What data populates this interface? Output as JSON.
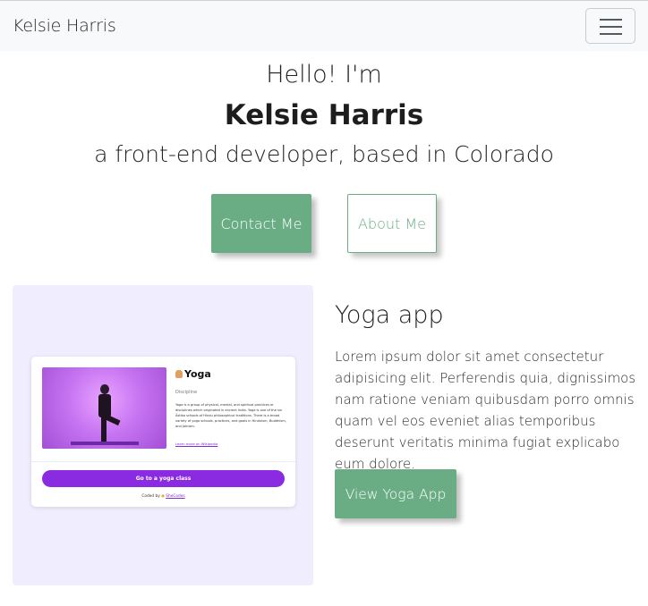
{
  "navbar": {
    "brand": "Kelsie Harris",
    "toggler_icon": "hamburger-menu-icon"
  },
  "hero": {
    "greeting": "Hello! I'm",
    "name": "Kelsie Harris",
    "subtitle": "a front-end developer, based in Colorado",
    "contact_label": "Contact Me",
    "about_label": "About Me"
  },
  "project": {
    "title": "Yoga app",
    "description": "Lorem ipsum dolor sit amet consectetur adipisicing elit. Perferendis quia, dignissimos nam ratione veniam quibusdam porro omnis quam vel eos eveniet alias temporibus deserunt veritatis minima fugiat explicabo eum dolore.",
    "button_label": "View Yoga App",
    "preview": {
      "title": "Yoga",
      "subtitle": "Discipline",
      "description": "Yoga is a group of physical, mental, and spiritual practices or disciplines which originated in ancient India. Yoga is one of the six Āstika schools of Hindu philosophical traditions. There is a broad variety of yoga schools, practices, and goals in Hinduism, Buddhism, and Jainism.",
      "link": "Learn more on Wikipedia",
      "button": "Go to a yoga class",
      "footer_prefix": "Coded by",
      "footer_name": "SheCodes"
    }
  },
  "colors": {
    "accent": "#6aad85",
    "preview_background": "#f0eefe",
    "preview_button": "#8a2be2"
  }
}
